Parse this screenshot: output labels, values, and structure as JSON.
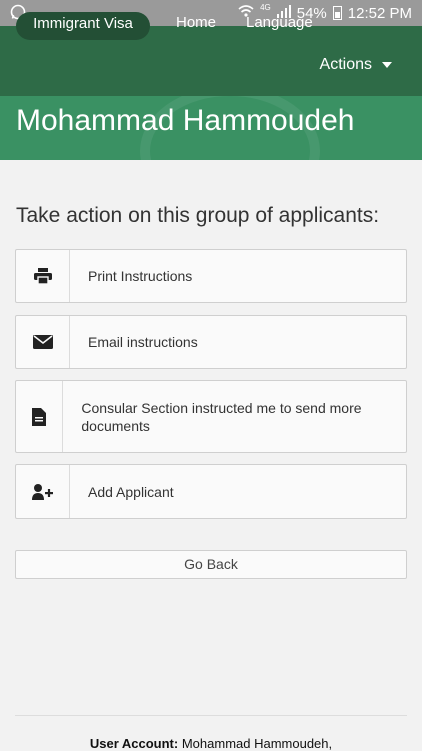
{
  "status_bar": {
    "network": "4G",
    "battery": "54%",
    "time": "12:52 PM"
  },
  "nav": {
    "pill_label": "Immigrant Visa",
    "home_label": "Home",
    "language_label": "Language",
    "actions_label": "Actions"
  },
  "banner": {
    "name": "Mohammad Hammoudeh"
  },
  "main": {
    "heading": "Take action on this group of applicants:",
    "actions": [
      {
        "label": "Print Instructions",
        "icon": "printer-icon"
      },
      {
        "label": "Email instructions",
        "icon": "envelope-icon"
      },
      {
        "label": "Consular Section instructed me to send more documents",
        "icon": "document-icon"
      },
      {
        "label": "Add Applicant",
        "icon": "add-user-icon"
      }
    ],
    "go_back_label": "Go Back"
  },
  "footer": {
    "account_label": "User Account:",
    "account_value": "Mohammad Hammoudeh,"
  },
  "colors": {
    "nav_bg": "#2e6b47",
    "banner_bg": "#3a9163"
  }
}
